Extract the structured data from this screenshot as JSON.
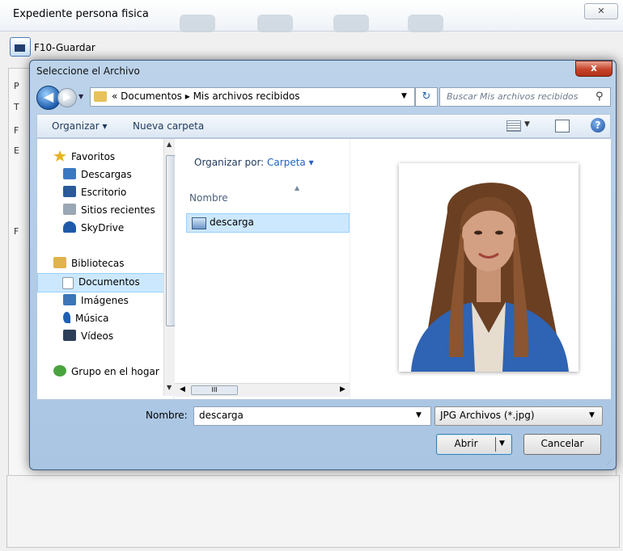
{
  "background_window": {
    "title": "Expediente persona fisica",
    "close_glyph": "✕",
    "toolbar_save": "F10-Guardar",
    "side_letters": [
      "P",
      "T",
      "F",
      "E",
      "F"
    ]
  },
  "dialog": {
    "title": "Seleccione el Archivo",
    "close_glyph": "x",
    "nav": {
      "back_glyph": "◀",
      "forward_glyph": "▶",
      "breadcrumb": "« Documentos ▸ Mis archivos recibidos",
      "dropdown_glyph": "▼",
      "refresh_glyph": "↻",
      "search_placeholder": "Buscar Mis archivos recibidos",
      "search_glyph": "⚲"
    },
    "commandbar": {
      "organize": "Organizar ▾",
      "new_folder": "Nueva carpeta",
      "view_dropdown": "▼",
      "help": "?"
    },
    "navigation_pane": {
      "items": [
        {
          "label": "Favoritos",
          "icon": "star-icon",
          "color": "#e6b422"
        },
        {
          "label": "Descargas",
          "icon": "downloads-icon",
          "color": "#3b78c2"
        },
        {
          "label": "Escritorio",
          "icon": "desktop-icon",
          "color": "#2a5a9a"
        },
        {
          "label": "Sitios recientes",
          "icon": "recent-places-icon",
          "color": "#9aa7b4"
        },
        {
          "label": "SkyDrive",
          "icon": "skydrive-icon",
          "color": "#1e5aa8"
        },
        {
          "label": "Bibliotecas",
          "icon": "libraries-icon",
          "color": "#e0b34c"
        },
        {
          "label": "Documentos",
          "icon": "documents-icon",
          "color": "#d8e2ee",
          "selected": true
        },
        {
          "label": "Imágenes",
          "icon": "pictures-icon",
          "color": "#3c75b8"
        },
        {
          "label": "Música",
          "icon": "music-icon",
          "color": "#1f5fb4"
        },
        {
          "label": "Vídeos",
          "icon": "videos-icon",
          "color": "#2d3f58"
        },
        {
          "label": "Grupo en el hogar",
          "icon": "homegroup-icon",
          "color": "#4aa33f"
        }
      ]
    },
    "file_pane": {
      "arrange_label": "Organizar por:",
      "arrange_value": "Carpeta ▾",
      "column_header": "Nombre",
      "files": [
        {
          "name": "descarga",
          "selected": true
        }
      ],
      "hscroll_thumb": "III"
    },
    "bottom": {
      "name_label": "Nombre:",
      "name_value": "descarga",
      "filetype_value": "JPG Archivos (*.jpg)",
      "open_label": "Abrir",
      "cancel_label": "Cancelar"
    }
  }
}
